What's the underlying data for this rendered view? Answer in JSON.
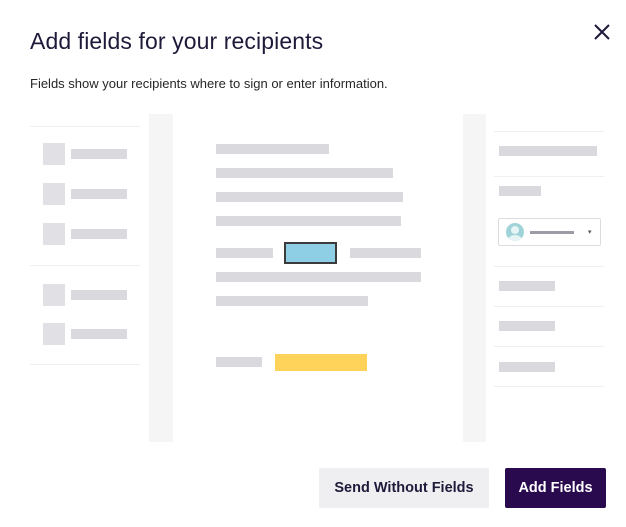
{
  "dialog": {
    "title": "Add fields for your recipients",
    "subtitle": "Fields show your recipients where to sign or enter information.",
    "close_icon": "close-icon"
  },
  "illustration": {
    "recipient_selector_icon": "person-avatar-icon",
    "caret_glyph": "▾",
    "field_colors": {
      "signature_field": "#8ecfe6",
      "text_field": "#ffd25a"
    }
  },
  "actions": {
    "secondary_label": "Send Without Fields",
    "primary_label": "Add Fields"
  },
  "colors": {
    "primary": "#2a0a4f",
    "secondary_bg": "#efeff2",
    "title": "#1f1a3a"
  }
}
